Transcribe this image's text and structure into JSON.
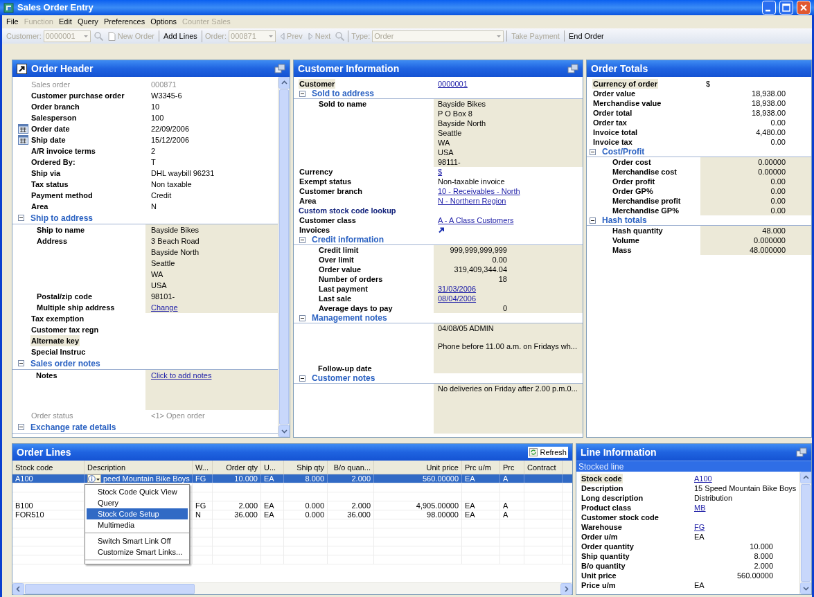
{
  "window": {
    "title": "Sales Order Entry"
  },
  "menu_bar": [
    {
      "label": "File",
      "disabled": false
    },
    {
      "label": "Function",
      "disabled": true
    },
    {
      "label": "Edit",
      "disabled": false
    },
    {
      "label": "Query",
      "disabled": false
    },
    {
      "label": "Preferences",
      "disabled": false
    },
    {
      "label": "Options",
      "disabled": false
    },
    {
      "label": "Counter Sales",
      "disabled": true
    }
  ],
  "toolbar": {
    "groups": [
      [
        {
          "kind": "combo",
          "label": "Customer:",
          "value": "0000001",
          "disabled": true
        },
        {
          "kind": "search",
          "disabled": true
        },
        {
          "kind": "doc_button",
          "label": "New Order",
          "disabled": true
        }
      ],
      [
        {
          "kind": "button",
          "label": "Add Lines",
          "disabled": false
        }
      ],
      [
        {
          "kind": "combo",
          "label": "Order:",
          "value": "000871",
          "disabled": true
        },
        {
          "kind": "back_button",
          "label": "Prev",
          "disabled": true
        },
        {
          "kind": "forward_button",
          "label": "Next",
          "disabled": true
        },
        {
          "kind": "search",
          "disabled": true
        }
      ],
      [
        {
          "kind": "combo",
          "label": "Type:",
          "value": "Order",
          "disabled": true
        }
      ],
      [
        {
          "kind": "button",
          "label": "Take Payment",
          "disabled": true
        }
      ],
      [
        {
          "kind": "button",
          "label": "End Order",
          "disabled": false
        }
      ]
    ]
  },
  "order_header": {
    "title": "Order Header",
    "rows": [
      {
        "kind": "field",
        "label": "Sales order",
        "value": "000871",
        "disabled": true
      },
      {
        "kind": "field",
        "label": "Customer purchase order",
        "value": "W3345-6"
      },
      {
        "kind": "field",
        "label": "Order branch",
        "value": "10"
      },
      {
        "kind": "field",
        "label": "Salesperson",
        "value": "100"
      },
      {
        "kind": "field",
        "label": "Order date",
        "value": "22/09/2006",
        "calendar": true
      },
      {
        "kind": "field",
        "label": "Ship date",
        "value": "15/12/2006",
        "calendar": true
      },
      {
        "kind": "field",
        "label": "A/R invoice terms",
        "value": "2"
      },
      {
        "kind": "field",
        "label": "Ordered By:",
        "value": "T"
      },
      {
        "kind": "field",
        "label": "Ship via",
        "value": "DHL waybill 96231"
      },
      {
        "kind": "field",
        "label": "Tax status",
        "value": "Non taxable"
      },
      {
        "kind": "field",
        "label": "Payment method",
        "value": "Credit"
      },
      {
        "kind": "field",
        "label": "Area",
        "value": "N"
      },
      {
        "kind": "section",
        "title": "Ship to address",
        "expanded": true,
        "children": [
          {
            "kind": "field",
            "label": "Ship to name",
            "value": "Bayside Bikes"
          },
          {
            "kind": "field",
            "label": "Address",
            "value": [
              "3 Beach Road",
              "Bayside North",
              "Seattle",
              "WA",
              "USA"
            ]
          },
          {
            "kind": "field",
            "label": "Postal/zip code",
            "value": "98101-"
          },
          {
            "kind": "link_field",
            "label": "Multiple ship address",
            "value": "Change"
          }
        ]
      },
      {
        "kind": "field",
        "label": "Tax exemption"
      },
      {
        "kind": "field",
        "label": "Customer tax regn"
      },
      {
        "kind": "field",
        "label": "Alternate key",
        "highlighted": true
      },
      {
        "kind": "field",
        "label": "Special Instruc"
      },
      {
        "kind": "section",
        "title": "Sales order notes",
        "expanded": true,
        "children": [
          {
            "kind": "link_note",
            "label": "Notes",
            "lines": [
              "Click to add notes"
            ]
          }
        ]
      },
      {
        "kind": "field",
        "label": "Order status",
        "value": "<1> Open order",
        "disabled": true
      },
      {
        "kind": "section",
        "title": "Exchange rate details",
        "expanded": true
      }
    ]
  },
  "customer_information": {
    "title": "Customer Information",
    "rows": [
      {
        "kind": "link_field",
        "label": "Customer",
        "value": "0000001",
        "highlighted": true
      },
      {
        "kind": "section",
        "title": "Sold to address",
        "expanded": true,
        "children": [
          {
            "kind": "field",
            "label": "Sold to name",
            "value": [
              "Bayside Bikes",
              "P O Box 8",
              "Bayside North",
              "Seattle",
              "WA",
              "USA",
              "98111-"
            ]
          }
        ]
      },
      {
        "kind": "link_field",
        "label": "Currency",
        "value": "$"
      },
      {
        "kind": "field",
        "label": "Exempt status",
        "value": "Non-taxable invoice"
      },
      {
        "kind": "link_field",
        "label": "Customer branch",
        "value": "10 - Receivables - North"
      },
      {
        "kind": "link_field",
        "label": "Area",
        "value": "N - Northern Region"
      },
      {
        "kind": "action",
        "label": "Custom stock code lookup"
      },
      {
        "kind": "link_field",
        "label": "Customer class",
        "value": "A - A Class Customers"
      },
      {
        "kind": "shortcut_field",
        "label": "Invoices"
      },
      {
        "kind": "section",
        "title": "Credit information",
        "expanded": true,
        "children": [
          {
            "kind": "number_field",
            "label": "Credit limit",
            "value": "999,999,999,999"
          },
          {
            "kind": "number_field",
            "label": "Over limit",
            "value": "0.00"
          },
          {
            "kind": "number_field",
            "label": "Order value",
            "value": "319,409,344.04"
          },
          {
            "kind": "number_field",
            "label": "Number of orders",
            "value": "18"
          },
          {
            "kind": "link_field",
            "label": "Last payment",
            "value": "31/03/2006"
          },
          {
            "kind": "link_field",
            "label": "Last sale",
            "value": "08/04/2006"
          },
          {
            "kind": "number_field",
            "label": "Average days to pay",
            "value": "0"
          }
        ]
      },
      {
        "kind": "section",
        "title": "Management notes",
        "expanded": true,
        "children": [
          {
            "kind": "note",
            "label": "Follow-up date",
            "lines": [
              "04/08/05 ADMIN",
              "Phone before 11.00 a.m. on Fridays wh..."
            ]
          }
        ]
      },
      {
        "kind": "section",
        "title": "Customer notes",
        "expanded": true,
        "children": [
          {
            "kind": "note",
            "lines": [
              "No deliveries on Friday after 2.00 p.m.0..."
            ]
          }
        ]
      }
    ]
  },
  "order_totals": {
    "title": "Order Totals",
    "rows": [
      {
        "kind": "field",
        "label": "Currency of order",
        "value": "$",
        "highlighted": true
      },
      {
        "kind": "number_field",
        "label": "Order value",
        "value": "18,938.00"
      },
      {
        "kind": "number_field",
        "label": "Merchandise value",
        "value": "18,938.00"
      },
      {
        "kind": "number_field",
        "label": "Order total",
        "value": "18,938.00"
      },
      {
        "kind": "number_field",
        "label": "Order tax",
        "value": "0.00"
      },
      {
        "kind": "number_field",
        "label": "Invoice total",
        "value": "4,480.00"
      },
      {
        "kind": "number_field",
        "label": "Invoice tax",
        "value": "0.00"
      },
      {
        "kind": "section",
        "title": "Cost/Profit",
        "expanded": true,
        "children": [
          {
            "kind": "number_field",
            "label": "Order cost",
            "value": "0.00000"
          },
          {
            "kind": "number_field",
            "label": "Merchandise cost",
            "value": "0.00000"
          },
          {
            "kind": "number_field",
            "label": "Order profit",
            "value": "0.00"
          },
          {
            "kind": "number_field",
            "label": "Order GP%",
            "value": "0.00"
          },
          {
            "kind": "number_field",
            "label": "Merchandise profit",
            "value": "0.00"
          },
          {
            "kind": "number_field",
            "label": "Merchandise GP%",
            "value": "0.00"
          }
        ]
      },
      {
        "kind": "section",
        "title": "Hash totals",
        "expanded": true,
        "children": [
          {
            "kind": "number_field",
            "label": "Hash quantity",
            "value": "48.000"
          },
          {
            "kind": "number_field",
            "label": "Volume",
            "value": "0.000000"
          },
          {
            "kind": "number_field",
            "label": "Mass",
            "value": "48.000000"
          }
        ]
      }
    ]
  },
  "order_lines": {
    "title": "Order Lines",
    "refresh": "Refresh",
    "columns": [
      {
        "label": "Stock code",
        "kind": "text"
      },
      {
        "label": "Description",
        "kind": "text"
      },
      {
        "label": "W...",
        "kind": "text"
      },
      {
        "label": "Order qty",
        "kind": "number"
      },
      {
        "label": "U...",
        "kind": "text"
      },
      {
        "label": "Ship qty",
        "kind": "number"
      },
      {
        "label": "B/o quan...",
        "kind": "number"
      },
      {
        "label": "Unit price",
        "kind": "number"
      },
      {
        "label": "Prc u/m",
        "kind": "text"
      },
      {
        "label": "Prc",
        "kind": "text"
      },
      {
        "label": "Contract",
        "kind": "text"
      }
    ],
    "rows": [
      {
        "kind": "line",
        "selected": true,
        "smart_link": true,
        "cells": [
          "A100",
          "peed Mountain Bike Boys",
          "FG",
          "10.000",
          "EA",
          "8.000",
          "2.000",
          "560.00000",
          "EA",
          "A"
        ]
      },
      {
        "kind": "comment"
      },
      {
        "kind": "comment"
      },
      {
        "kind": "line",
        "selected": false,
        "cells": [
          "B100",
          null,
          "FG",
          "2.000",
          "EA",
          "0.000",
          "2.000",
          "4,905.00000",
          "EA",
          "A"
        ]
      },
      {
        "kind": "line",
        "selected": false,
        "cells": [
          "FOR510",
          null,
          "N",
          "36.000",
          "EA",
          "0.000",
          "36.000",
          "98.00000",
          "EA",
          "A"
        ]
      }
    ],
    "context_menu": {
      "groups": [
        [
          {
            "label": "Stock Code Quick View",
            "selected": false
          },
          {
            "label": "Query",
            "selected": false
          },
          {
            "label": "Stock Code Setup",
            "selected": true
          },
          {
            "label": "Multimedia",
            "selected": false
          }
        ],
        [
          {
            "label": "Switch Smart Link Off",
            "selected": false
          },
          {
            "label": "Customize Smart Links...",
            "selected": false
          }
        ]
      ]
    }
  },
  "line_information": {
    "title": "Line Information",
    "subtitle": "Stocked line",
    "rows": [
      {
        "kind": "link_field",
        "label": "Stock code",
        "value": "A100",
        "highlighted": true
      },
      {
        "kind": "field",
        "label": "Description",
        "value": "15 Speed Mountain Bike Boys"
      },
      {
        "kind": "field",
        "label": "Long description",
        "value": "Distribution"
      },
      {
        "kind": "link_field",
        "label": "Product class",
        "value": "MB"
      },
      {
        "kind": "field",
        "label": "Customer stock code"
      },
      {
        "kind": "link_field",
        "label": "Warehouse",
        "value": "FG"
      },
      {
        "kind": "field",
        "label": "Order u/m",
        "value": "EA"
      },
      {
        "kind": "number_field",
        "label": "Order quantity",
        "value": "10.000"
      },
      {
        "kind": "number_field",
        "label": "Ship quantity",
        "value": "8.000"
      },
      {
        "kind": "number_field",
        "label": "B/o quantity",
        "value": "2.000"
      },
      {
        "kind": "number_field",
        "label": "Unit price",
        "value": "560.00000"
      },
      {
        "kind": "field",
        "label": "Price u/m",
        "value": "EA"
      }
    ]
  }
}
